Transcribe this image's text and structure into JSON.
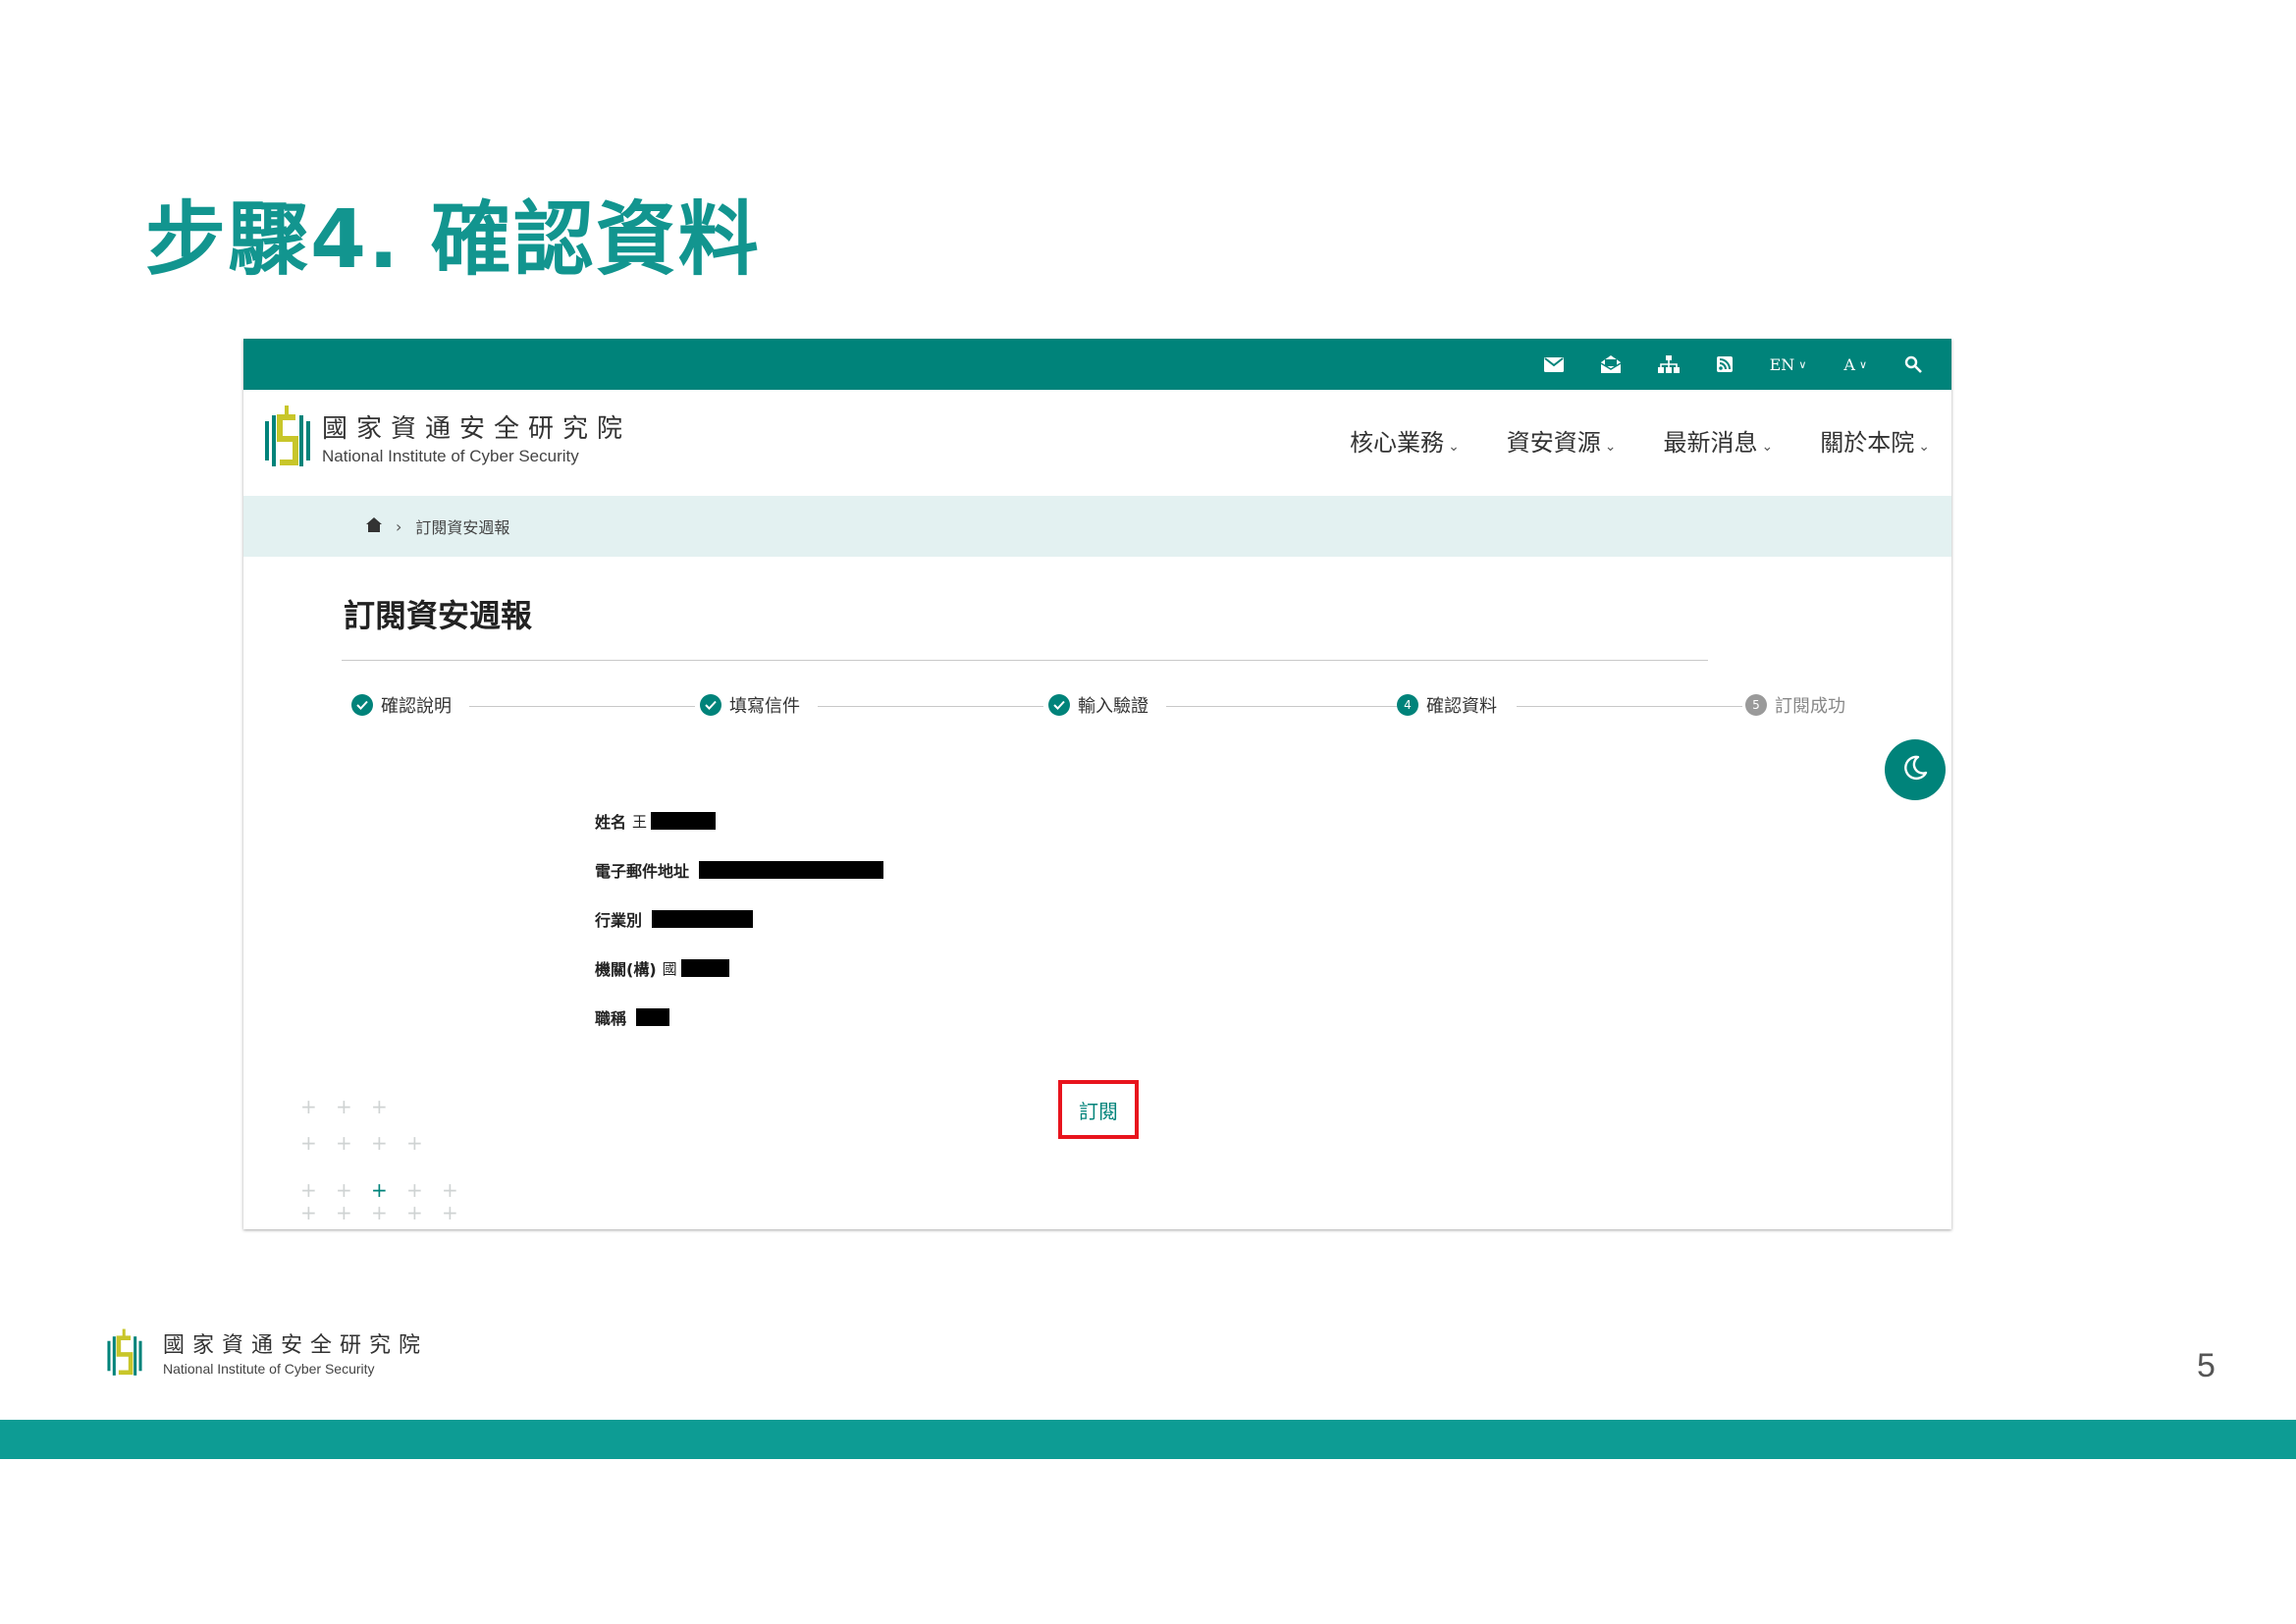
{
  "slide": {
    "title": "步驟4. 確認資料",
    "page_number": "5"
  },
  "colors": {
    "brand_teal": "#00837a",
    "title_teal": "#12958f",
    "breadcrumb_bg": "#e3f1f1",
    "highlight_red": "#e8141d",
    "logo_yellow": "#c8c62a"
  },
  "site": {
    "org_name_zh": "國家資通安全研究院",
    "org_name_en": "National Institute of Cyber Security",
    "utility": {
      "icons": [
        "mail-icon",
        "open-mail-icon",
        "sitemap-icon",
        "rss-icon"
      ],
      "lang_label": "EN",
      "font_size_label": "A",
      "search_icon": "search-icon"
    },
    "nav": [
      {
        "label": "核心業務"
      },
      {
        "label": "資安資源"
      },
      {
        "label": "最新消息"
      },
      {
        "label": "關於本院"
      }
    ],
    "chevron": "⌄",
    "breadcrumb": {
      "home_icon": "home-icon",
      "separator": "›",
      "current": "訂閱資安週報"
    }
  },
  "page": {
    "heading": "訂閱資安週報",
    "steps": [
      {
        "label": "確認說明",
        "status": "done",
        "badge": ""
      },
      {
        "label": "填寫信件",
        "status": "done",
        "badge": ""
      },
      {
        "label": "輸入驗證",
        "status": "done",
        "badge": ""
      },
      {
        "label": "確認資料",
        "status": "current",
        "badge": "4"
      },
      {
        "label": "訂閱成功",
        "status": "pending",
        "badge": "5"
      }
    ],
    "fields": [
      {
        "label": "姓名",
        "prefix": "王",
        "redaction": 0.35
      },
      {
        "label": "電子郵件地址",
        "prefix": "",
        "redaction": 1.0
      },
      {
        "label": "行業別",
        "prefix": "",
        "redaction": 0.55
      },
      {
        "label": "機關(構)",
        "prefix": "國",
        "redaction": 0.26
      },
      {
        "label": "職稱",
        "prefix": "",
        "redaction": 0.18
      }
    ],
    "subscribe_label": "訂閱",
    "dark_mode_icon": "moon-icon"
  }
}
